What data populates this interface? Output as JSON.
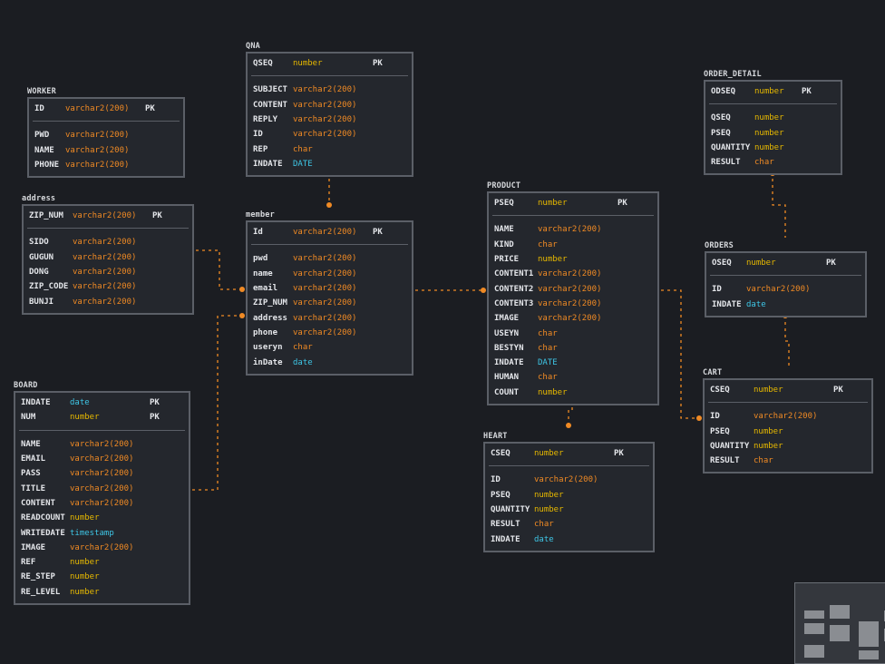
{
  "tables": [
    {
      "id": "qna",
      "title": "QNA",
      "keys": [
        {
          "name": "QSEQ",
          "type": "number",
          "pk": "PK"
        }
      ],
      "cols": [
        {
          "name": "SUBJECT",
          "type": "varchar2(200)"
        },
        {
          "name": "CONTENT",
          "type": "varchar2(200)"
        },
        {
          "name": "REPLY",
          "type": "varchar2(200)"
        },
        {
          "name": "ID",
          "type": "varchar2(200)"
        },
        {
          "name": "REP",
          "type": "char"
        },
        {
          "name": "INDATE",
          "type": "DATE"
        }
      ]
    },
    {
      "id": "worker",
      "title": "WORKER",
      "keys": [
        {
          "name": "ID",
          "type": "varchar2(200)",
          "pk": "PK"
        }
      ],
      "cols": [
        {
          "name": "PWD",
          "type": "varchar2(200)"
        },
        {
          "name": "NAME",
          "type": "varchar2(200)"
        },
        {
          "name": "PHONE",
          "type": "varchar2(200)"
        }
      ]
    },
    {
      "id": "address",
      "title": "address",
      "keys": [
        {
          "name": "ZIP_NUM",
          "type": "varchar2(200)",
          "pk": "PK"
        }
      ],
      "cols": [
        {
          "name": "SIDO",
          "type": "varchar2(200)"
        },
        {
          "name": "GUGUN",
          "type": "varchar2(200)"
        },
        {
          "name": "DONG",
          "type": "varchar2(200)"
        },
        {
          "name": "ZIP_CODE",
          "type": "varchar2(200)"
        },
        {
          "name": "BUNJI",
          "type": "varchar2(200)"
        }
      ]
    },
    {
      "id": "member",
      "title": "member",
      "keys": [
        {
          "name": "Id",
          "type": "varchar2(200)",
          "pk": "PK"
        }
      ],
      "cols": [
        {
          "name": "pwd",
          "type": "varchar2(200)"
        },
        {
          "name": "name",
          "type": "varchar2(200)"
        },
        {
          "name": "email",
          "type": "varchar2(200)"
        },
        {
          "name": "ZIP_NUM",
          "type": "varchar2(200)"
        },
        {
          "name": "address",
          "type": "varchar2(200)"
        },
        {
          "name": "phone",
          "type": "varchar2(200)"
        },
        {
          "name": "useryn",
          "type": "char"
        },
        {
          "name": "inDate",
          "type": "date"
        }
      ]
    },
    {
      "id": "board",
      "title": "BOARD",
      "keys": [
        {
          "name": "INDATE",
          "type": "date",
          "pk": "PK"
        },
        {
          "name": "NUM",
          "type": "number",
          "pk": "PK"
        }
      ],
      "cols": [
        {
          "name": "NAME",
          "type": "varchar2(200)"
        },
        {
          "name": "EMAIL",
          "type": "varchar2(200)"
        },
        {
          "name": "PASS",
          "type": "varchar2(200)"
        },
        {
          "name": "TITLE",
          "type": "varchar2(200)"
        },
        {
          "name": "CONTENT",
          "type": "varchar2(200)"
        },
        {
          "name": "READCOUNT",
          "type": "number"
        },
        {
          "name": "WRITEDATE",
          "type": "timestamp"
        },
        {
          "name": "IMAGE",
          "type": "varchar2(200)"
        },
        {
          "name": "REF",
          "type": "number"
        },
        {
          "name": "RE_STEP",
          "type": "number"
        },
        {
          "name": "RE_LEVEL",
          "type": "number"
        }
      ]
    },
    {
      "id": "product",
      "title": "PRODUCT",
      "keys": [
        {
          "name": "PSEQ",
          "type": "number",
          "pk": "PK"
        }
      ],
      "cols": [
        {
          "name": "NAME",
          "type": "varchar2(200)"
        },
        {
          "name": "KIND",
          "type": "char"
        },
        {
          "name": "PRICE",
          "type": "number"
        },
        {
          "name": "CONTENT1",
          "type": "varchar2(200)"
        },
        {
          "name": "CONTENT2",
          "type": "varchar2(200)"
        },
        {
          "name": "CONTENT3",
          "type": "varchar2(200)"
        },
        {
          "name": "IMAGE",
          "type": "varchar2(200)"
        },
        {
          "name": "USEYN",
          "type": "char"
        },
        {
          "name": "BESTYN",
          "type": "char"
        },
        {
          "name": "INDATE",
          "type": "DATE"
        },
        {
          "name": "HUMAN",
          "type": "char"
        },
        {
          "name": "COUNT",
          "type": "number"
        }
      ]
    },
    {
      "id": "heart",
      "title": "HEART",
      "keys": [
        {
          "name": "CSEQ",
          "type": "number",
          "pk": "PK"
        }
      ],
      "cols": [
        {
          "name": "ID",
          "type": "varchar2(200)"
        },
        {
          "name": "PSEQ",
          "type": "number"
        },
        {
          "name": "QUANTITY",
          "type": "number"
        },
        {
          "name": "RESULT",
          "type": "char"
        },
        {
          "name": "INDATE",
          "type": "date"
        }
      ]
    },
    {
      "id": "order_detail",
      "title": "ORDER_DETAIL",
      "keys": [
        {
          "name": "ODSEQ",
          "type": "number",
          "pk": "PK"
        }
      ],
      "cols": [
        {
          "name": "QSEQ",
          "type": "number"
        },
        {
          "name": "PSEQ",
          "type": "number"
        },
        {
          "name": "QUANTITY",
          "type": "number"
        },
        {
          "name": "RESULT",
          "type": "char"
        }
      ]
    },
    {
      "id": "orders",
      "title": "ORDERS",
      "keys": [
        {
          "name": "OSEQ",
          "type": "number",
          "pk": "PK"
        }
      ],
      "cols": [
        {
          "name": "ID",
          "type": "varchar2(200)"
        },
        {
          "name": "INDATE",
          "type": "date"
        }
      ]
    },
    {
      "id": "cart",
      "title": "CART",
      "keys": [
        {
          "name": "CSEQ",
          "type": "number",
          "pk": "PK"
        }
      ],
      "cols": [
        {
          "name": "ID",
          "type": "varchar2(200)"
        },
        {
          "name": "PSEQ",
          "type": "number"
        },
        {
          "name": "QUANTITY",
          "type": "number"
        },
        {
          "name": "RESULT",
          "type": "char"
        }
      ]
    }
  ],
  "colors": {
    "background": "#1b1d22",
    "connector": "#f08a24",
    "varchar": "#f08a24",
    "number": "#e6b800",
    "date": "#3ec6e6"
  }
}
